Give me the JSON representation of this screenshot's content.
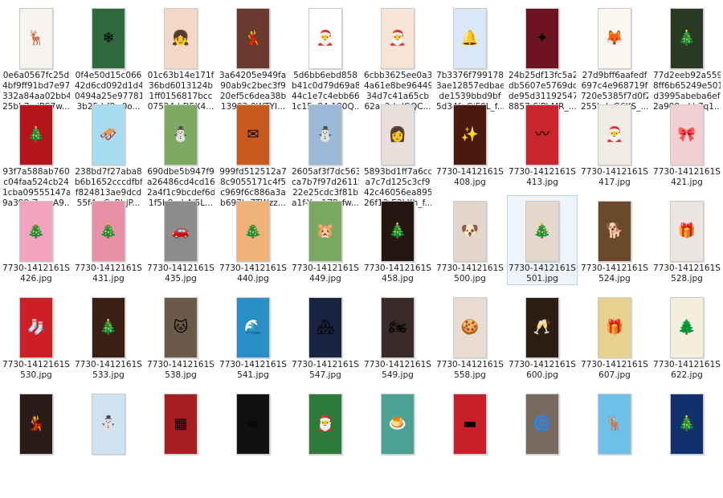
{
  "files": [
    {
      "name": "0e6a0567fc25d\n4bf9ff91bd7e97\n332a84aa02bb4\n25bb7-cjBS7w...",
      "icon": "reindeer-thumbnail-icon",
      "glyph": "🦌",
      "bg": "#f7f3ee"
    },
    {
      "name": "0f4e50d15c066\n42d6cd092d1d4\n0494a25e97781\n3b25d-f8w0o...",
      "icon": "snowflake-thumbnail-icon",
      "glyph": "❄",
      "bg": "#2f6a3c"
    },
    {
      "name": "01c63b14e171f\n36bd6013124b\n1ff0156817bcc\n07524d-D5X4...",
      "icon": "cartoon-girl-thumbnail-icon",
      "glyph": "👧",
      "bg": "#f3d8c8"
    },
    {
      "name": "3a64205e949faf\n90ab9c2bec3f9\n20ef5c6dea38b\n13903-9WTYI...",
      "icon": "santa-woman-thumbnail-icon",
      "glyph": "💃",
      "bg": "#6a3a2e"
    },
    {
      "name": "5d6bb6ebd858\nb41c0d79d69a8\n44c1e7c4ebb66\n1c15a84-180Q...",
      "icon": "minion-thumbnail-icon",
      "glyph": "🎅",
      "bg": "#ffffff"
    },
    {
      "name": "6cbb3625ee0a3\n4a61e8be96449\n34d7c41a65cb\n62ac2d-dGQC...",
      "icon": "santa-drawing-thumbnail-icon",
      "glyph": "🎅",
      "bg": "#f6e4d6"
    },
    {
      "name": "7b3376f799178\n3ae12857edbae\nde1539bbd9bf\n5d34f-rGiF0L_f...",
      "icon": "bells-thumbnail-icon",
      "glyph": "🔔",
      "bg": "#d8e8f6"
    },
    {
      "name": "24b25df13fc5a2\ndb5607e5769dc\nde95d31192547\n8857-SjPbMR_...",
      "icon": "dark-red-card-thumbnail-icon",
      "glyph": "✦",
      "bg": "#6e1420"
    },
    {
      "name": "27d9bff6aafedf\n697c4e968719f\n720e5385f7d0f2\n255b-JpG6KS_...",
      "icon": "fox-card-thumbnail-icon",
      "glyph": "🦊",
      "bg": "#fbf6ef"
    },
    {
      "name": "77d2eeb92a559\n8ff6b65249e501\nd3995abeba6ef\n2a909e-Lb7q1...",
      "icon": "girl-tree-thumbnail-icon",
      "glyph": "🎄",
      "bg": "#2a3a22"
    },
    {
      "name": "93f7a588ab760\nc04faa524cb24\n1cba09555147a\n9a399-ZwmA9...",
      "icon": "red-tree-card-thumbnail-icon",
      "glyph": "🎄",
      "bg": "#b4151d"
    },
    {
      "name": "238bd7f27aba8\nb6b1652cccdfbf\nf824813ae9dcd\n55f4c-CeRbjP...",
      "icon": "cartoon-sleigh-thumbnail-icon",
      "glyph": "🛷",
      "bg": "#a8dcef"
    },
    {
      "name": "690dbe5b947f9\na26486cd4cd16\n2a4f1c9bcdef6d\n1f5b9-uhAi5L...",
      "icon": "snowman-thumbnail-icon",
      "glyph": "⛄",
      "bg": "#7fa862"
    },
    {
      "name": "999fd512512a7\n8c9055171c4f5\nc969f6c886a3a\nb697b-7TWzz...",
      "icon": "orange-card-thumbnail-icon",
      "glyph": "✉",
      "bg": "#c85a1e"
    },
    {
      "name": "2605af3f7dc563\nca7b7f97d26115\n22e25cdc3f81b\na1f-Yza1ZP_fw...",
      "icon": "snow-scene-thumbnail-icon",
      "glyph": "⛄",
      "bg": "#9bb8d6"
    },
    {
      "name": "5893bd1ff7a6cd\na7c7d125c3cf9\n42c46056ea895\n26f12-E2LXh_f...",
      "icon": "reindeer-girl-thumbnail-icon",
      "glyph": "👩",
      "bg": "#e9dfda"
    },
    {
      "name": "7730-1412161S\n408.jpg",
      "icon": "lights-thumbnail-icon",
      "glyph": "✨",
      "bg": "#4a1a0e"
    },
    {
      "name": "7730-1412161S\n413.jpg",
      "icon": "chevron-card-thumbnail-icon",
      "glyph": "〰",
      "bg": "#c8252e"
    },
    {
      "name": "7730-1412161S\n417.jpg",
      "icon": "santa-figure-thumbnail-icon",
      "glyph": "🎅",
      "bg": "#f1ebe5"
    },
    {
      "name": "7730-1412161S\n421.jpg",
      "icon": "pink-ornaments-thumbnail-icon",
      "glyph": "🎀",
      "bg": "#f2cfd2"
    },
    {
      "name": "7730-1412161S\n426.jpg",
      "icon": "pink-tree-thumbnail-icon",
      "glyph": "🎄",
      "bg": "#f2a3bf"
    },
    {
      "name": "7730-1412161S\n431.jpg",
      "icon": "pink-tree-room-thumbnail-icon",
      "glyph": "🎄",
      "bg": "#e890a6"
    },
    {
      "name": "7730-1412161S\n435.jpg",
      "icon": "snow-car-thumbnail-icon",
      "glyph": "🚗",
      "bg": "#8c8c8c"
    },
    {
      "name": "7730-1412161S\n440.jpg",
      "icon": "bauble-thumbnail-icon",
      "glyph": "🎄",
      "bg": "#efb37a"
    },
    {
      "name": "7730-1412161S\n449.jpg",
      "icon": "guinea-pig-thumbnail-icon",
      "glyph": "🐹",
      "bg": "#79a861"
    },
    {
      "name": "7730-1412161S\n458.jpg",
      "icon": "bokeh-tree-thumbnail-icon",
      "glyph": "🎄",
      "bg": "#24170f"
    },
    {
      "name": "7730-1412161S\n500.jpg",
      "icon": "pug-thumbnail-icon",
      "glyph": "🐶",
      "bg": "#e1d6c9"
    },
    {
      "name": "7730-1412161S\n501.jpg",
      "icon": "small-tree-thumbnail-icon",
      "glyph": "🎄",
      "bg": "#e4d8cc"
    },
    {
      "name": "7730-1412161S\n524.jpg",
      "icon": "dog-scarf-thumbnail-icon",
      "glyph": "🐕",
      "bg": "#6a4a2a"
    },
    {
      "name": "7730-1412161S\n528.jpg",
      "icon": "hanging-ornaments-thumbnail-icon",
      "glyph": "🎁",
      "bg": "#ece6e2"
    },
    {
      "name": "7730-1412161S\n530.jpg",
      "icon": "red-socks-thumbnail-icon",
      "glyph": "🧦",
      "bg": "#cc2026"
    },
    {
      "name": "7730-1412161S\n533.jpg",
      "icon": "cupcake-tree-thumbnail-icon",
      "glyph": "🎄",
      "bg": "#3a1f14"
    },
    {
      "name": "7730-1412161S\n538.jpg",
      "icon": "cat-hat-thumbnail-icon",
      "glyph": "🐱",
      "bg": "#6b5a4a"
    },
    {
      "name": "7730-1412161S\n541.jpg",
      "icon": "blue-water-thumbnail-icon",
      "glyph": "🌊",
      "bg": "#2a8fc6"
    },
    {
      "name": "7730-1412161S\n547.jpg",
      "icon": "night-town-thumbnail-icon",
      "glyph": "🏘",
      "bg": "#1a2440"
    },
    {
      "name": "7730-1412161S\n549.jpg",
      "icon": "motorbike-santa-thumbnail-icon",
      "glyph": "🏍",
      "bg": "#3a2a2a"
    },
    {
      "name": "7730-1412161S\n558.jpg",
      "icon": "cookies-thumbnail-icon",
      "glyph": "🍪",
      "bg": "#e8dcd0"
    },
    {
      "name": "7730-1412161S\n600.jpg",
      "icon": "champagne-thumbnail-icon",
      "glyph": "🥂",
      "bg": "#2e1e12"
    },
    {
      "name": "7730-1412161S\n607.jpg",
      "icon": "gift-boxes-thumbnail-icon",
      "glyph": "🎁",
      "bg": "#e8d090"
    },
    {
      "name": "7730-1412161S\n622.jpg",
      "icon": "mini-trees-thumbnail-icon",
      "glyph": "🌲",
      "bg": "#f4eedc"
    },
    {
      "name": "",
      "icon": "santa-girl-thumbnail-icon",
      "glyph": "💃",
      "bg": "#2a1a18"
    },
    {
      "name": "",
      "icon": "snow-hill-thumbnail-icon",
      "glyph": "⛄",
      "bg": "#cfe3f2"
    },
    {
      "name": "",
      "icon": "calendar-grid-thumbnail-icon",
      "glyph": "▦",
      "bg": "#a81d22"
    },
    {
      "name": "",
      "icon": "skull-hat-thumbnail-icon",
      "glyph": "☠",
      "bg": "#111111"
    },
    {
      "name": "",
      "icon": "green-card-thumbnail-icon",
      "glyph": "🎅",
      "bg": "#2d7a3a"
    },
    {
      "name": "",
      "icon": "teal-pudding-card-thumbnail-icon",
      "glyph": "🍮",
      "bg": "#4aa392"
    },
    {
      "name": "",
      "icon": "red-banner-thumbnail-icon",
      "glyph": "▬",
      "bg": "#c81f2a"
    },
    {
      "name": "",
      "icon": "spiral-shell-thumbnail-icon",
      "glyph": "🌀",
      "bg": "#7a6a5e"
    },
    {
      "name": "",
      "icon": "rudolph-cartoon-thumbnail-icon",
      "glyph": "🦌",
      "bg": "#6fc0e8"
    },
    {
      "name": "",
      "icon": "star-tree-thumbnail-icon",
      "glyph": "🎄",
      "bg": "#10306e"
    }
  ],
  "selected_index": 27
}
